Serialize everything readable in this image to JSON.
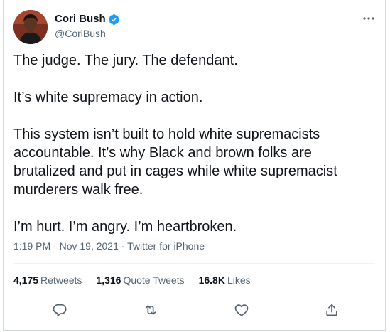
{
  "user": {
    "name": "Cori Bush",
    "handle": "@CoriBush"
  },
  "tweet": {
    "paragraphs": [
      "The judge. The jury. The defendant.",
      "It’s white supremacy in action.",
      "This system isn’t built to hold white supremacists accountable. It’s why Black and brown folks are brutalized and put in cages while white supremacist murderers walk free.",
      "I’m hurt. I’m angry. I’m heartbroken."
    ],
    "time": "1:19 PM",
    "date": "Nov 19, 2021",
    "source": "Twitter for iPhone",
    "separator": "·"
  },
  "stats": {
    "retweets": {
      "count": "4,175",
      "label": "Retweets"
    },
    "quotes": {
      "count": "1,316",
      "label": "Quote Tweets"
    },
    "likes": {
      "count": "16.8K",
      "label": "Likes"
    }
  },
  "icons": {
    "verified": "verified-badge-icon",
    "more": "more-options-icon",
    "reply": "reply-icon",
    "retweet": "retweet-icon",
    "like": "like-icon",
    "share": "share-icon"
  },
  "colors": {
    "text": "#0f1419",
    "secondary": "#536471",
    "verified": "#1d9bf0",
    "border": "#cfd9de"
  }
}
